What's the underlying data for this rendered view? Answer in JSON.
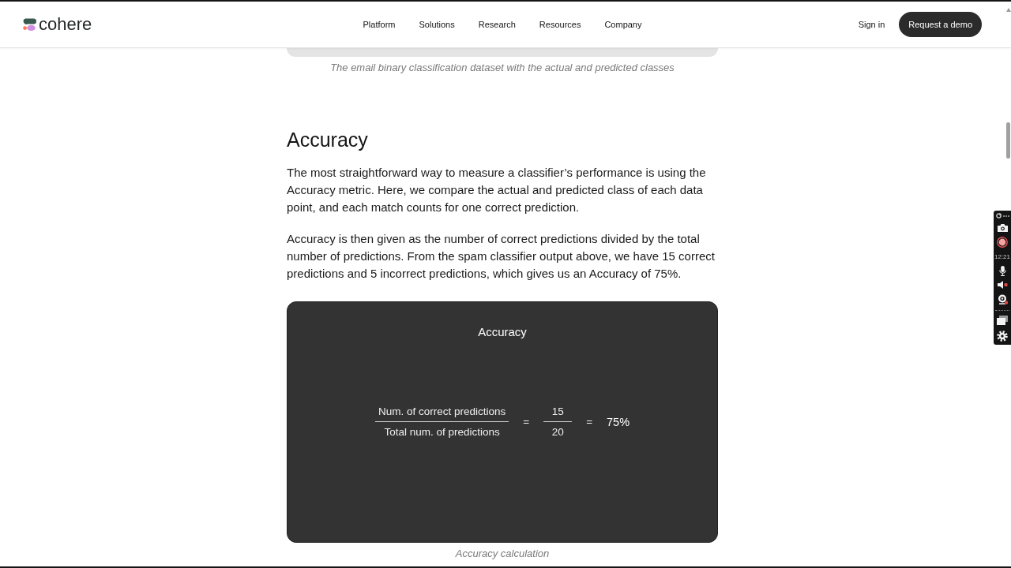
{
  "nav": {
    "logo": "cohere",
    "links": [
      "Platform",
      "Solutions",
      "Research",
      "Resources",
      "Company"
    ],
    "sign_in": "Sign in",
    "cta_button": "Request a demo"
  },
  "previous_figure": {
    "caption": "The email binary classification dataset with the actual and predicted classes"
  },
  "section": {
    "heading": "Accuracy",
    "paragraphs": [
      "The most straightforward way to measure a classifier’s performance is using the Accuracy metric. Here, we compare the actual and predicted class of each data point, and each match counts for one correct prediction.",
      "Accuracy is then given as the number of correct predictions divided by the total number of predictions. From the spam classifier output above, we have 15 correct predictions and 5 incorrect predictions, which gives us an Accuracy of 75%."
    ]
  },
  "figure": {
    "title": "Accuracy",
    "equation": [
      {
        "kind": "fraction",
        "numerator": "Num. of correct predictions",
        "denominator": "Total num. of predictions"
      },
      {
        "kind": "operator",
        "text": "="
      },
      {
        "kind": "fraction",
        "numerator": "15",
        "denominator": "20"
      },
      {
        "kind": "operator",
        "text": "="
      },
      {
        "kind": "result",
        "text": "75%"
      }
    ],
    "caption": "Accuracy calculation"
  },
  "recorder_toolbar": {
    "timer": "12:21"
  }
}
